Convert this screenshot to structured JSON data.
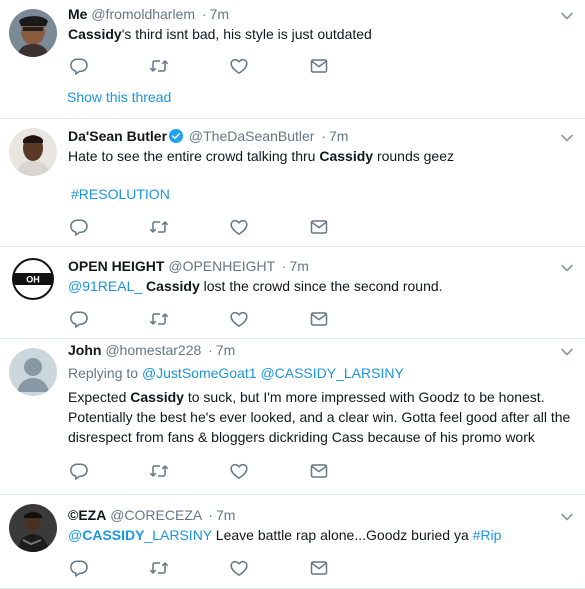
{
  "tweets": [
    {
      "name": "Me",
      "handle": "@fromoldharlem",
      "sep": "·",
      "time": "7m",
      "text_bold": "Cassidy",
      "text_rest": "'s third isnt bad, his style is just outdated",
      "show_thread": "Show this thread"
    },
    {
      "name": "Da'Sean Butler",
      "verified": true,
      "handle": "@TheDaSeanButler",
      "sep": "·",
      "time": "7m",
      "text_pre": "Hate to see the entire crowd talking thru ",
      "text_bold": "Cassidy",
      "text_post": " rounds geez",
      "hashtag": "#RESOLUTION"
    },
    {
      "name": "OPEN HEIGHT",
      "handle": "@OPENHEIGHT",
      "sep": "·",
      "time": "7m",
      "mention": "@91REAL_",
      "text_bold": "Cassidy",
      "text_post": " lost the crowd since the second round."
    },
    {
      "name": "John",
      "handle": "@homestar228",
      "sep": "·",
      "time": "7m",
      "replying_label": "Replying to ",
      "replying_to_1": "@JustSomeGoat1",
      "replying_to_2": "@CASSIDY_LARSINY",
      "line1_pre": "Expected ",
      "line1_bold": "Cassidy",
      "line1_post": " to suck, but I'm more impressed with Goodz to be honest.",
      "line2": "Potentially the best he's ever looked, and a clear win. Gotta feel good after all the",
      "line3": "disrespect from fans & bloggers dickriding Cass because of his promo work"
    },
    {
      "name": "©EZA",
      "handle": "@CORECEZA",
      "sep": "·",
      "time": "7m",
      "mention_at": "@",
      "mention_bold": "CASSIDY",
      "mention_rest": "_LARSINY",
      "text_post": " Leave battle rap alone...Goodz buried ya ",
      "hashtag": "#Rip"
    }
  ],
  "icons": [
    "reply-icon",
    "retweet-icon",
    "like-icon",
    "message-icon",
    "chevron-down-icon",
    "verified-badge-icon"
  ],
  "colors": {
    "link": "#1b95e0",
    "muted": "#657786",
    "text": "#14171a",
    "divider": "#e6ecf0",
    "icon": "#657786"
  }
}
